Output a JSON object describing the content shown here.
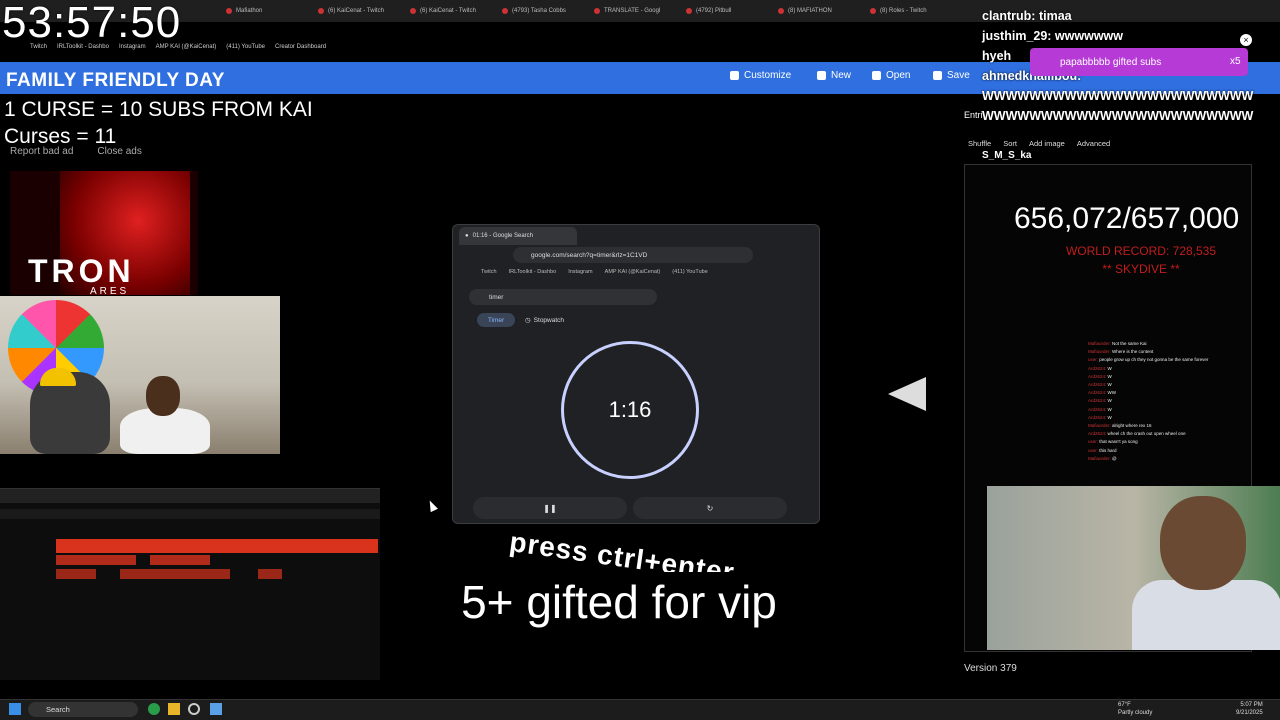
{
  "stream_clock": "53:57:50",
  "browser_tabs": [
    "Mafiathon",
    "(6) KaiCenat - Twitch",
    "(6) KaiCenat - Twitch",
    "(4793) Tasha Cobbs",
    "TRANSLATE - Googl",
    "(4792) Pitbull",
    "(8) MAFIATHON",
    "(8) Roles - Twitch"
  ],
  "bookmarks": [
    "Twitch",
    "IRLToolkit - Dashbo",
    "Instagram",
    "AMP KAI (@KaiCenat)",
    "(411) YouTube",
    "Creator Dashboard"
  ],
  "toolbar": {
    "customize": "Customize",
    "new": "New",
    "open": "Open",
    "save": "Save"
  },
  "overlay": {
    "day_title": "FAMILY FRIENDLY DAY",
    "curse_rule": "1 CURSE = 10 SUBS FROM KAI",
    "curse_count": "Curses = 11",
    "report_ad": "Report bad ad",
    "close_ads": "Close ads",
    "ad_title": "TRON",
    "ad_sub": "ARES",
    "press_text": "press ctrl+enter",
    "gifted": "5+ gifted for vip"
  },
  "search_window": {
    "tab_title": "01:16 - Google Search",
    "url": "google.com/search?q=timer&rlz=1C1VD",
    "bookmarks": [
      "Twitch",
      "IRLToolkit - Dashbo",
      "Instagram",
      "AMP KAI (@KaiCenat)",
      "(411) YouTube"
    ],
    "query": "timer",
    "tab_timer": "Timer",
    "tab_stopwatch": "Stopwatch",
    "timer_value": "1:16",
    "pause_icon": "❚❚",
    "reset_icon": "↻"
  },
  "chat_top": [
    "clantrub: timaa",
    "justhim_29: wwwwwww",
    "hyeh",
    "ahmedkhalilbou:",
    "WWWWWWWWWWWWWWWWWWWWWWW",
    "WWWWWWWWWWWWWWWWWWWWWWW"
  ],
  "sub_alert": {
    "text": "papabbbbb gifted subs",
    "count": "x5"
  },
  "wheel_panel": {
    "entries_label": "Entri",
    "shuffle": "Shuffle",
    "sort": "Sort",
    "add_image": "Add image",
    "advanced": "Advanced",
    "chatter": "S_M_S_ka"
  },
  "counter": {
    "value": "656,072/657,000",
    "record": "WORLD RECORD: 728,535",
    "record_note": "** SKYDIVE **"
  },
  "chatlog": [
    {
      "name": "Mafiaorder",
      "msg": "Not the same Kai"
    },
    {
      "name": "Mafiaorder",
      "msg": "Where is the content"
    },
    {
      "name": "user",
      "msg": "people grow up ch they not gonna be the same forever"
    },
    {
      "name": "Ard2624",
      "msg": "W"
    },
    {
      "name": "Ard2624",
      "msg": "W"
    },
    {
      "name": "Ard2624",
      "msg": "W"
    },
    {
      "name": "Ard2624",
      "msg": "WW"
    },
    {
      "name": "Ard2624",
      "msg": "W"
    },
    {
      "name": "Ard2624",
      "msg": "W"
    },
    {
      "name": "Ard2624",
      "msg": "W"
    },
    {
      "name": "Mafiaorder",
      "msg": "alright where rex 16"
    },
    {
      "name": "Ard2624",
      "msg": "wheel ch the crash out open wheel one"
    },
    {
      "name": "user",
      "msg": "that wasn't ya song"
    },
    {
      "name": "user",
      "msg": "this hard"
    },
    {
      "name": "Mafiaorder",
      "msg": "@"
    }
  ],
  "version": "Version 379",
  "taskbar": {
    "search": "Search",
    "weather_temp": "67°F",
    "weather_desc": "Partly cloudy",
    "time": "5:07 PM",
    "date": "9/21/2025"
  },
  "colors": {
    "toolbar_blue": "#2f6fe0",
    "alert_purple": "#b63ad6",
    "record_red": "#c21d1d",
    "wave_red": "#d9331e"
  }
}
